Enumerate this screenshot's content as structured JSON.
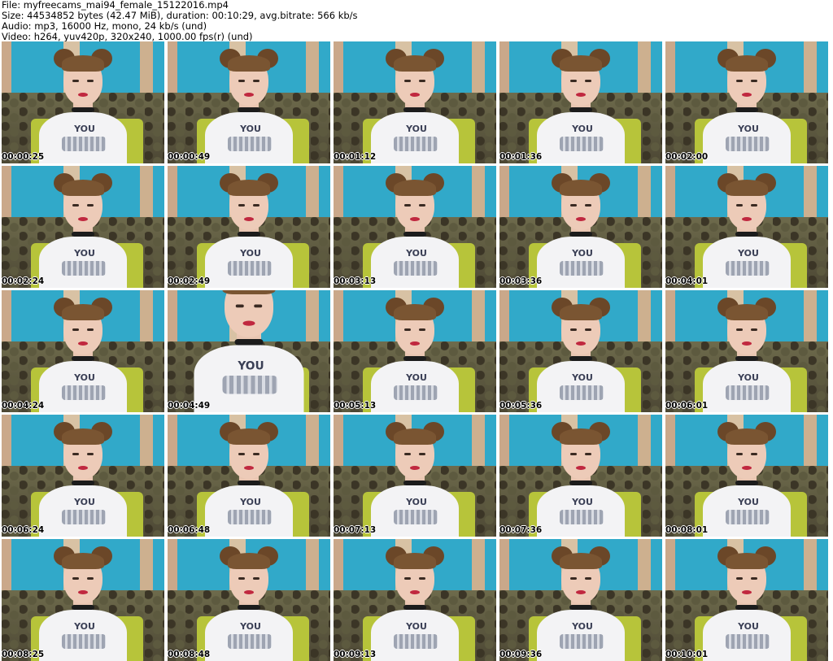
{
  "header": {
    "file": "File: myfreecams_mai94_female_15122016.mp4",
    "size": "Size: 44534852 bytes (42.47 MiB), duration: 00:10:29, avg.bitrate: 566 kb/s",
    "audio": "Audio: mp3, 16000 Hz, mono, 24 kb/s (und)",
    "video": "Video: h264, yuv420p, 320x240, 1000.00 fps(r) (und)"
  },
  "thumbnails": [
    {
      "timestamp": "00:00:25"
    },
    {
      "timestamp": "00:00:49"
    },
    {
      "timestamp": "00:01:12"
    },
    {
      "timestamp": "00:01:36"
    },
    {
      "timestamp": "00:02:00"
    },
    {
      "timestamp": "00:02:24"
    },
    {
      "timestamp": "00:02:49"
    },
    {
      "timestamp": "00:03:13"
    },
    {
      "timestamp": "00:03:36"
    },
    {
      "timestamp": "00:04:01"
    },
    {
      "timestamp": "00:04:24"
    },
    {
      "timestamp": "00:04:49"
    },
    {
      "timestamp": "00:05:13"
    },
    {
      "timestamp": "00:05:36"
    },
    {
      "timestamp": "00:06:01"
    },
    {
      "timestamp": "00:06:24"
    },
    {
      "timestamp": "00:06:48"
    },
    {
      "timestamp": "00:07:13"
    },
    {
      "timestamp": "00:07:36"
    },
    {
      "timestamp": "00:08:01"
    },
    {
      "timestamp": "00:08:25"
    },
    {
      "timestamp": "00:08:48"
    },
    {
      "timestamp": "00:09:13"
    },
    {
      "timestamp": "00:09:36"
    },
    {
      "timestamp": "00:10:01"
    }
  ],
  "shirt_print": "YOU"
}
